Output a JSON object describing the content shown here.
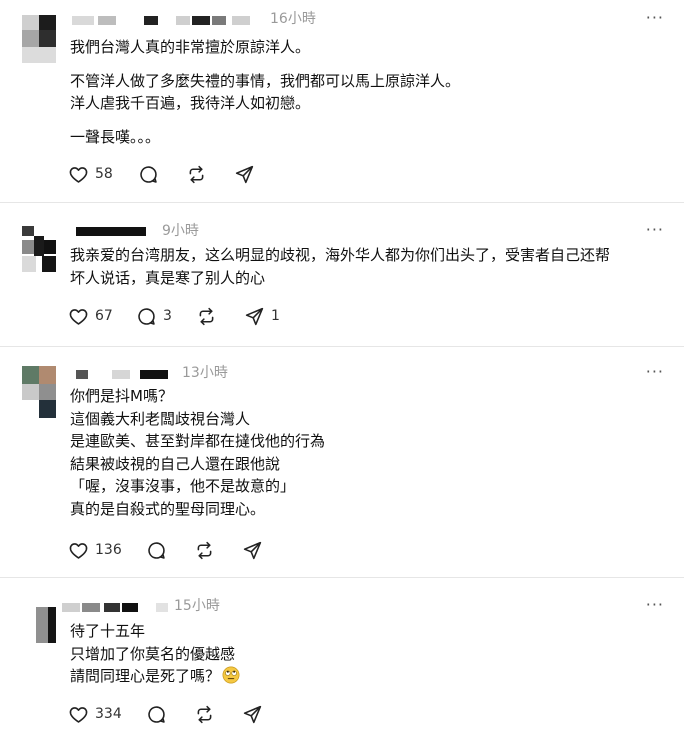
{
  "posts": [
    {
      "time": "16小時",
      "lines": [
        "我們台灣人真的非常擅於原諒洋人。",
        "",
        "不管洋人做了多麼失禮的事情，我們都可以馬上原諒洋人。",
        "洋人虐我千百遍，我待洋人如初戀。",
        "",
        "一聲長嘆。。。"
      ],
      "likes": "58",
      "replies": "",
      "shares": ""
    },
    {
      "time": "9小時",
      "lines": [
        "我亲爱的台湾朋友，这么明显的歧视，海外华人都为你们出头了，受害者自己还帮",
        "坏人说话，真是寒了别人的心"
      ],
      "likes": "67",
      "replies": "3",
      "shares": "1"
    },
    {
      "time": "13小時",
      "lines": [
        "你們是抖M嗎？",
        "這個義大利老闆歧視台灣人",
        "是連歐美、甚至對岸都在撻伐他的行為",
        "結果被歧視的自己人還在跟他說",
        "「喔，沒事沒事，他不是故意的」",
        "真的是自殺式的聖母同理心。"
      ],
      "likes": "136",
      "replies": "",
      "shares": ""
    },
    {
      "time": "15小時",
      "lines": [
        "待了十五年",
        "只增加了你莫名的優越感",
        "請問同理心是死了嗎？"
      ],
      "likes": "334",
      "replies": "",
      "shares": ""
    }
  ],
  "icons": {
    "like": "heart-icon",
    "reply": "comment-icon",
    "repost": "repost-icon",
    "share": "send-icon",
    "more": "more-icon",
    "emoji": "rolling-eyes-emoji"
  },
  "more_label": "···"
}
